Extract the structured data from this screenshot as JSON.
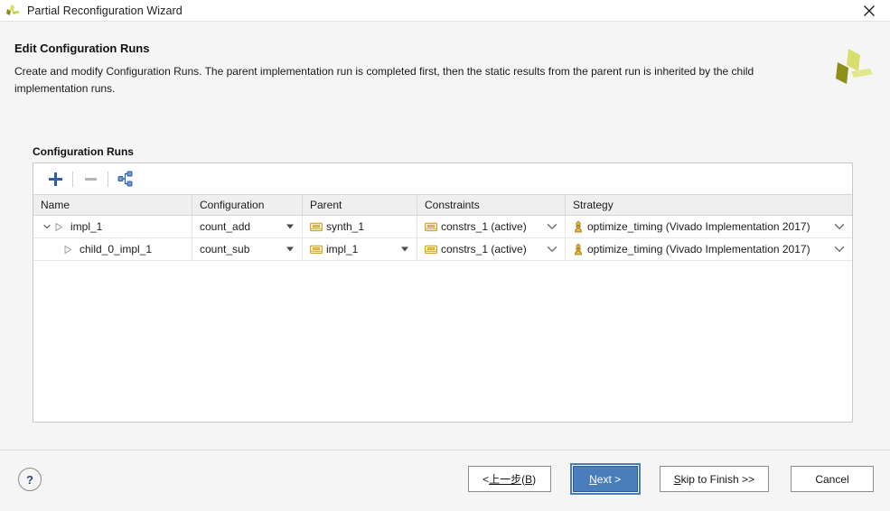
{
  "window": {
    "title": "Partial Reconfiguration Wizard",
    "app_icon": "xilinx-logo-icon",
    "close_icon": "close-icon"
  },
  "header": {
    "title": "Edit Configuration Runs",
    "description": "Create and modify Configuration Runs. The parent implementation run is completed first, then the static results from the parent run is inherited by the child implementation runs.",
    "brand_icon": "xilinx-logo-icon"
  },
  "section": {
    "label": "Configuration Runs"
  },
  "toolbar": {
    "add_label": "+",
    "remove_label": "−",
    "hierarchy_label": "hierarchy"
  },
  "table": {
    "columns": [
      "Name",
      "Configuration",
      "Parent",
      "Constraints",
      "Strategy"
    ],
    "rows": [
      {
        "name": "impl_1",
        "indent": 0,
        "expanded": true,
        "configuration": "count_add",
        "configuration_dropdown": true,
        "parent": "synth_1",
        "parent_dropdown": false,
        "constraints": "constrs_1 (active)",
        "constraints_dropdown": true,
        "strategy": "optimize_timing (Vivado Implementation 2017)",
        "strategy_dropdown": true
      },
      {
        "name": "child_0_impl_1",
        "indent": 1,
        "expanded": false,
        "configuration": "count_sub",
        "configuration_dropdown": true,
        "parent": "impl_1",
        "parent_dropdown": true,
        "constraints": "constrs_1 (active)",
        "constraints_dropdown": true,
        "strategy": "optimize_timing (Vivado Implementation 2017)",
        "strategy_dropdown": true
      }
    ]
  },
  "footer": {
    "help_label": "?",
    "back_button": {
      "prefix": "< ",
      "underlined": "上一步",
      "suffix_open": "(",
      "mnemonic": "B",
      "suffix_close": ")"
    },
    "next_button": {
      "mnemonic": "N",
      "rest": "ext >"
    },
    "skip_button": {
      "mnemonic": "S",
      "rest": "kip to Finish >>"
    },
    "cancel_button": "Cancel"
  },
  "colors": {
    "primary_button": "#4a7ebb",
    "panel_background": "#ffffff",
    "window_background": "#f5f5f5",
    "icon_gold": "#d3a81b",
    "icon_blue": "#2f5da8",
    "logo_olive": "#8d8f18",
    "logo_lime": "#d8de6b"
  }
}
